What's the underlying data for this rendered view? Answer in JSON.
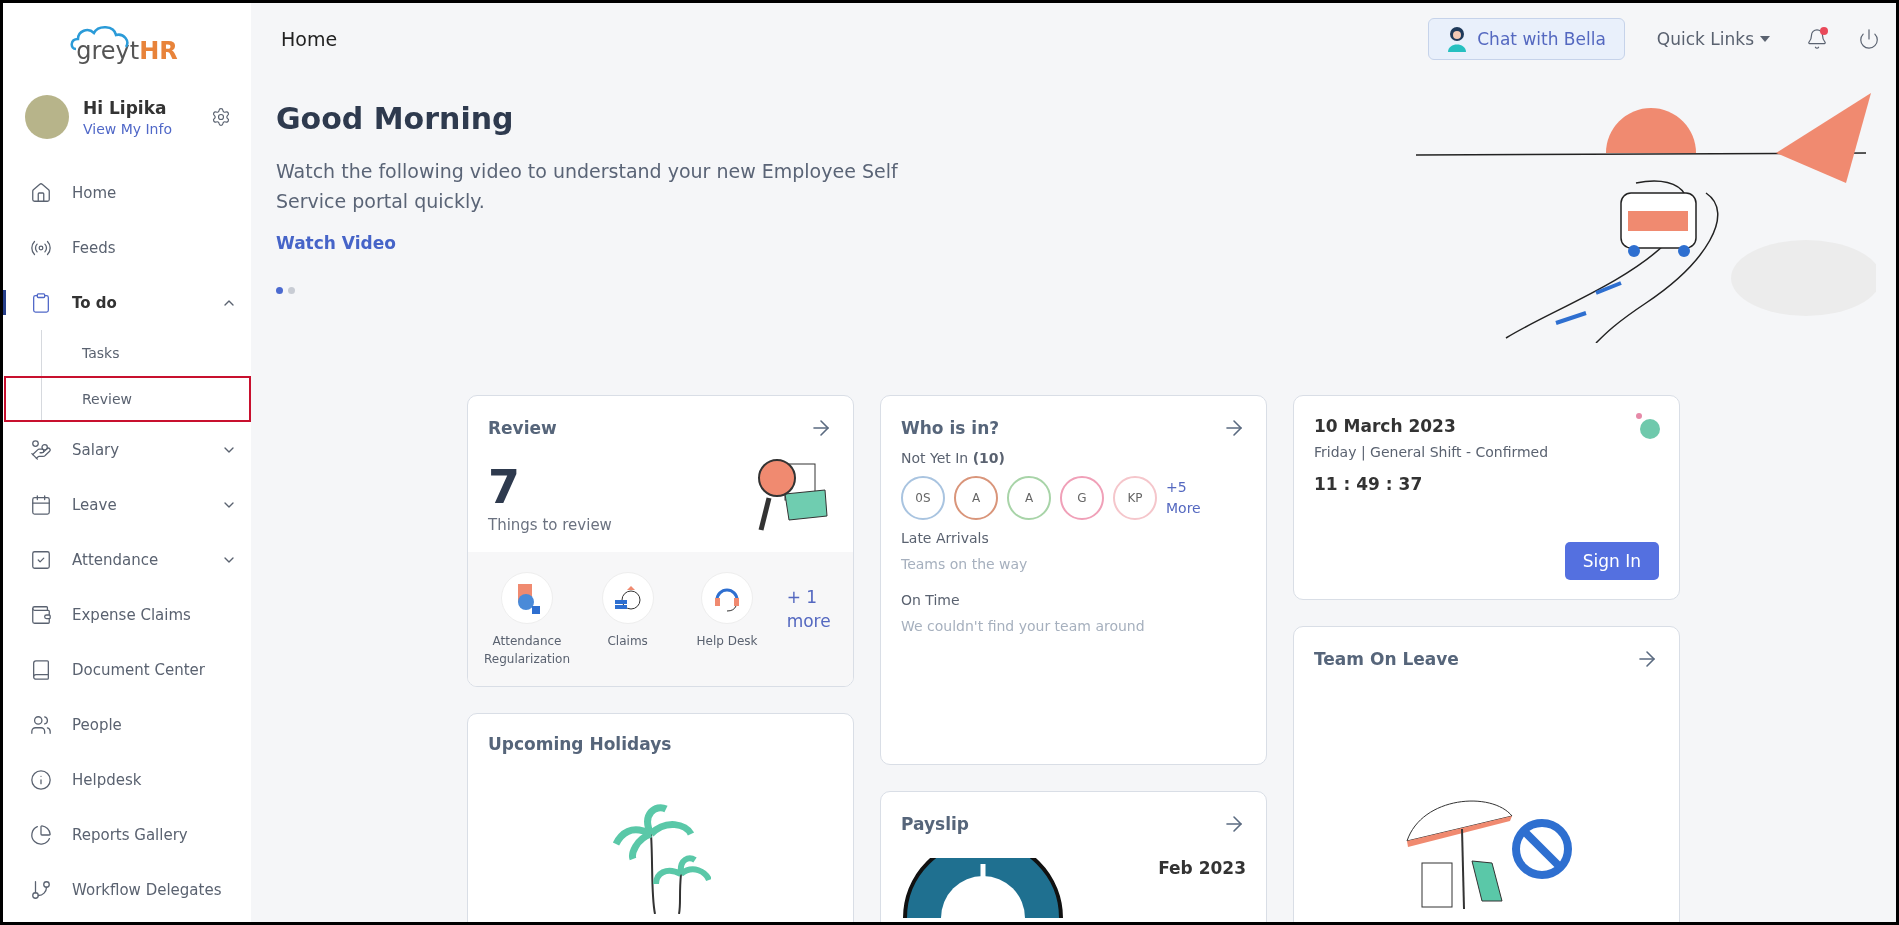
{
  "sidebar": {
    "logo": {
      "part_1": "greyt",
      "part_2": "HR"
    },
    "user": {
      "greeting": "Hi Lipika",
      "link": "View My Info"
    },
    "nav": [
      {
        "label": "Home",
        "selected": false
      },
      {
        "label": "Feeds",
        "selected": false
      },
      {
        "label": "To do",
        "selected": true,
        "expanded": true,
        "children": [
          {
            "label": "Tasks",
            "highlighted": false
          },
          {
            "label": "Review",
            "highlighted": true
          }
        ]
      },
      {
        "label": "Salary",
        "selected": false,
        "expanded": false
      },
      {
        "label": "Leave",
        "selected": false,
        "expanded": false
      },
      {
        "label": "Attendance",
        "selected": false,
        "expanded": false
      },
      {
        "label": "Expense Claims",
        "selected": false
      },
      {
        "label": "Document Center",
        "selected": false
      },
      {
        "label": "People",
        "selected": false
      },
      {
        "label": "Helpdesk",
        "selected": false
      },
      {
        "label": "Reports Gallery",
        "selected": false
      },
      {
        "label": "Workflow Delegates",
        "selected": false
      }
    ]
  },
  "header": {
    "title": "Home",
    "chat_button": "Chat with Bella",
    "quick_links": "Quick Links",
    "notifications_unread": true
  },
  "banner": {
    "title": "Good Morning",
    "text": "Watch the following video to understand your new Employee Self Service portal quickly.",
    "link": "Watch Video",
    "dots": [
      {
        "selected": true
      },
      {
        "selected": false
      }
    ]
  },
  "review_card": {
    "title": "Review",
    "count": "7",
    "caption": "Things to review",
    "shortcuts": [
      {
        "label": "Attendance Regularization"
      },
      {
        "label": "Claims"
      },
      {
        "label": "Help Desk"
      }
    ],
    "more": "+ 1 more"
  },
  "who_is_in_card": {
    "title": "Who is in?",
    "not_yet_in": "Not Yet In **(10)**",
    "avatars": [
      {
        "initials": "0S",
        "color": "#a9c4e0"
      },
      {
        "initials": "A",
        "color": "#d9957a"
      },
      {
        "initials": "A",
        "color": "#a8d4a8"
      },
      {
        "initials": "G",
        "color": "#f0a0b8"
      },
      {
        "initials": "KP",
        "color": "#f5c6cb"
      }
    ],
    "more": "+5 More",
    "sections": [
      {
        "heading": "Late Arrivals",
        "text": "Teams on the way"
      },
      {
        "heading": "On Time",
        "text": "We couldn't find your team around"
      }
    ]
  },
  "attendance_card": {
    "date": "10 March 2023",
    "shift": "Friday | General Shift - Confirmed",
    "time": "11 : 49 : 37",
    "button": "Sign In"
  },
  "team_on_leave_card": {
    "title": "Team On Leave"
  },
  "holidays_card": {
    "title": "Upcoming Holidays"
  },
  "payslip_card": {
    "title": "Payslip",
    "month": "Feb 2023"
  }
}
